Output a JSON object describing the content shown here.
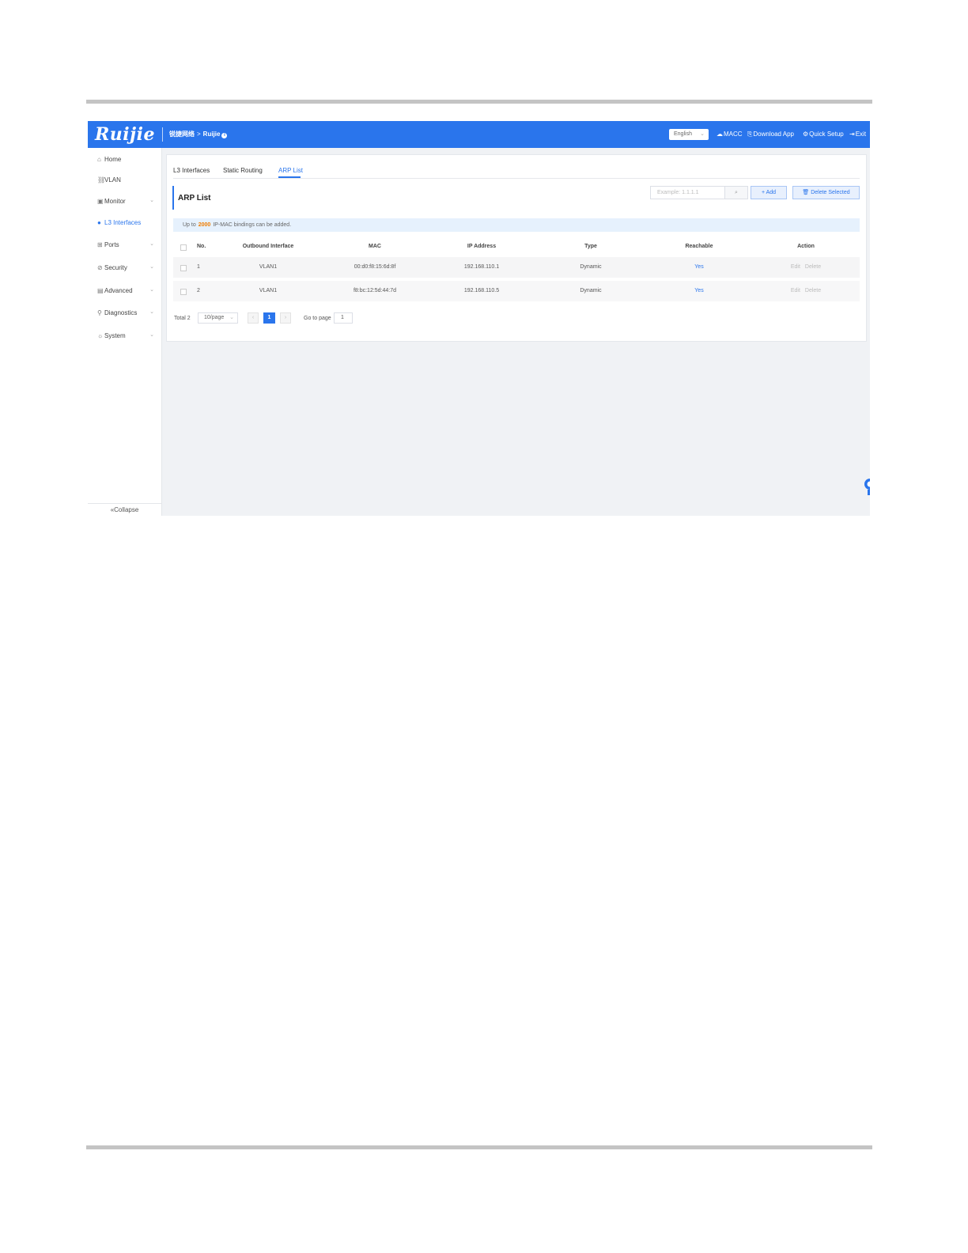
{
  "header": {
    "logo": "Ruijie",
    "breadcrumb_root": "锐捷网络",
    "breadcrumb_sep": ">",
    "breadcrumb_current": "Ruijie",
    "language": "English",
    "links": {
      "macc": "MACC",
      "download_app": "Download App",
      "quick_setup": "Quick Setup",
      "exit": "Exit"
    }
  },
  "sidebar": {
    "items": [
      {
        "label": "Home",
        "icon": "home-icon"
      },
      {
        "label": "VLAN",
        "icon": "vlan-icon"
      },
      {
        "label": "Monitor",
        "icon": "monitor-icon",
        "expandable": true
      },
      {
        "label": "L3 Interfaces",
        "icon": "globe-icon",
        "active": true
      },
      {
        "label": "Ports",
        "icon": "ports-icon",
        "expandable": true
      },
      {
        "label": "Security",
        "icon": "security-icon",
        "expandable": true
      },
      {
        "label": "Advanced",
        "icon": "advanced-icon",
        "expandable": true
      },
      {
        "label": "Diagnostics",
        "icon": "diagnostics-icon",
        "expandable": true
      },
      {
        "label": "System",
        "icon": "system-icon",
        "expandable": true
      }
    ],
    "collapse": "Collapse"
  },
  "tabs": [
    {
      "label": "L3 Interfaces"
    },
    {
      "label": "Static Routing"
    },
    {
      "label": "ARP List",
      "active": true
    }
  ],
  "panel": {
    "title": "ARP List",
    "search_placeholder": "Example: 1.1.1.1",
    "add_label": "Add",
    "delete_selected_label": "Delete Selected",
    "notice_prefix": "Up to",
    "notice_count": "2000",
    "notice_suffix": "IP-MAC bindings can be added."
  },
  "table": {
    "columns": [
      "No.",
      "Outbound Interface",
      "MAC",
      "IP Address",
      "Type",
      "Reachable",
      "Action"
    ],
    "rows": [
      {
        "no": "1",
        "interface": "VLAN1",
        "mac": "00:d0:f8:15:6d:8f",
        "ip": "192.168.110.1",
        "type": "Dynamic",
        "reachable": "Yes"
      },
      {
        "no": "2",
        "interface": "VLAN1",
        "mac": "f8:bc:12:5d:44:7d",
        "ip": "192.168.110.5",
        "type": "Dynamic",
        "reachable": "Yes"
      }
    ],
    "actions": {
      "edit": "Edit",
      "delete": "Delete"
    }
  },
  "pagination": {
    "total": "Total 2",
    "page_size": "10/page",
    "current_page": "1",
    "goto_label": "Go to page",
    "goto_value": "1"
  },
  "colors": {
    "accent": "#2a75ec",
    "notice_count": "#f07c00",
    "header_bg": "#2a75ec"
  }
}
